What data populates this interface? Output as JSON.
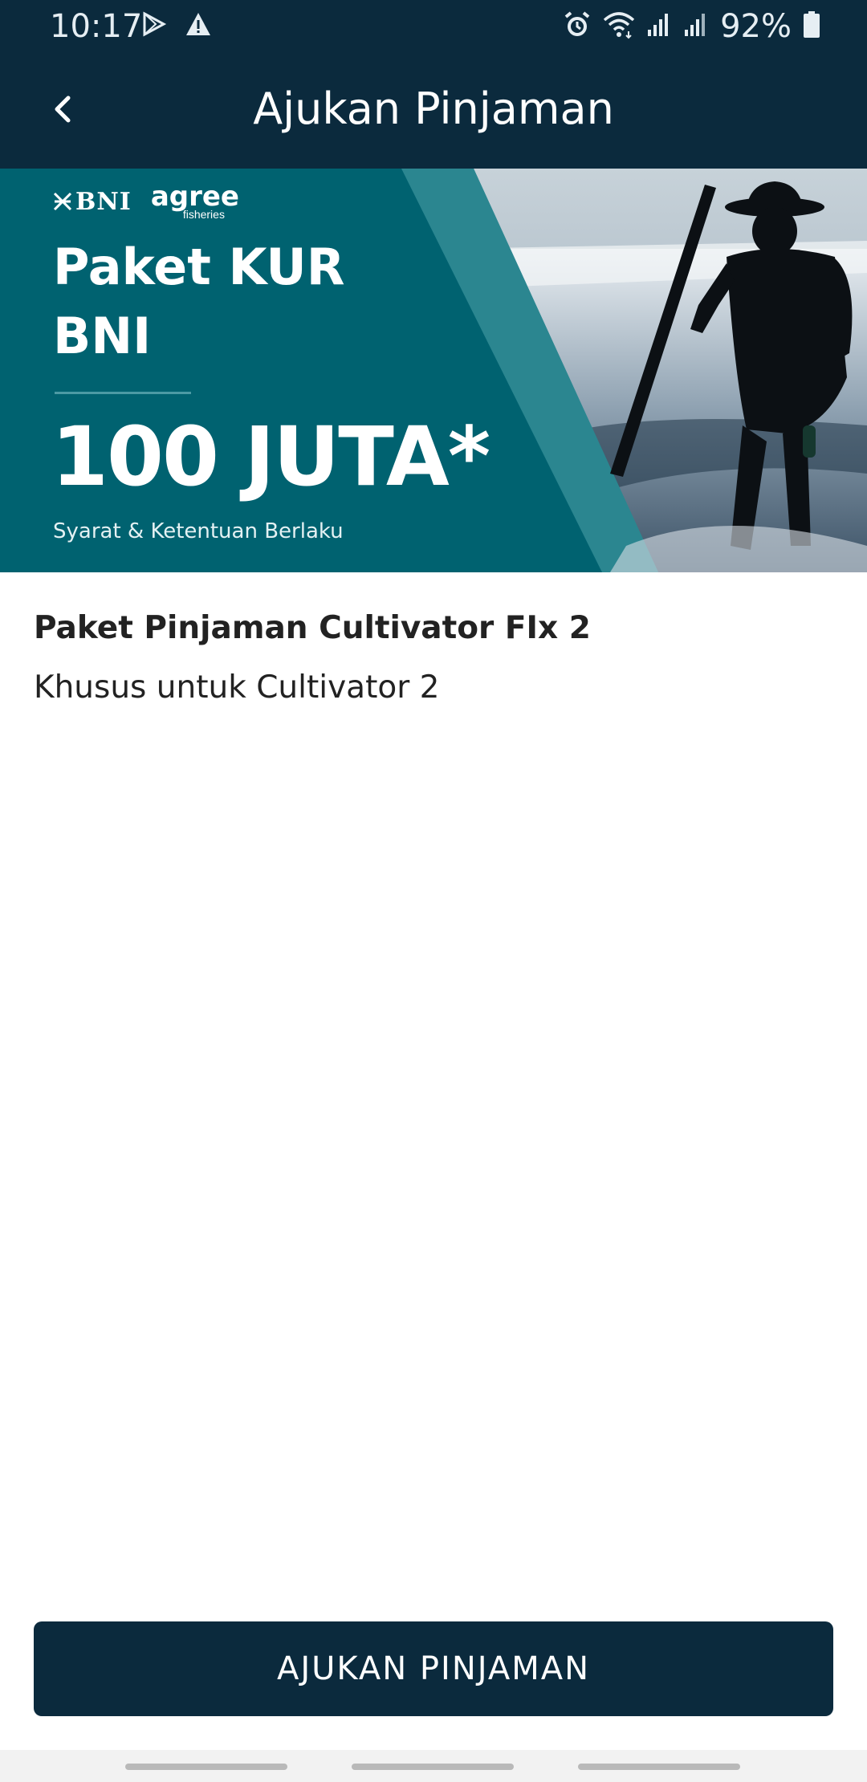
{
  "status_bar": {
    "time": "10:17",
    "battery_percent": "92%",
    "icons": [
      "play-store-icon",
      "warning-icon",
      "alarm-icon",
      "wifi-icon",
      "signal-icon",
      "signal-icon",
      "battery-icon"
    ]
  },
  "app_bar": {
    "title": "Ajukan Pinjaman",
    "back_icon": "chevron-left-icon"
  },
  "banner": {
    "logo_bni": "BNI",
    "logo_agree": "agree",
    "logo_agree_sub": "fisheries",
    "headline_line1": "Paket KUR",
    "headline_line2": "BNI",
    "amount": "100 JUTA*",
    "terms": "Syarat & Ketentuan Berlaku",
    "colors": {
      "primary": "#006270",
      "accent": "#2f8a94"
    }
  },
  "package": {
    "title": "Paket Pinjaman Cultivator FIx 2",
    "description": "Khusus untuk Cultivator 2"
  },
  "actions": {
    "submit_label": "AJUKAN PINJAMAN"
  },
  "theme": {
    "navy": "#0b2a3d",
    "background": "#ffffff"
  }
}
